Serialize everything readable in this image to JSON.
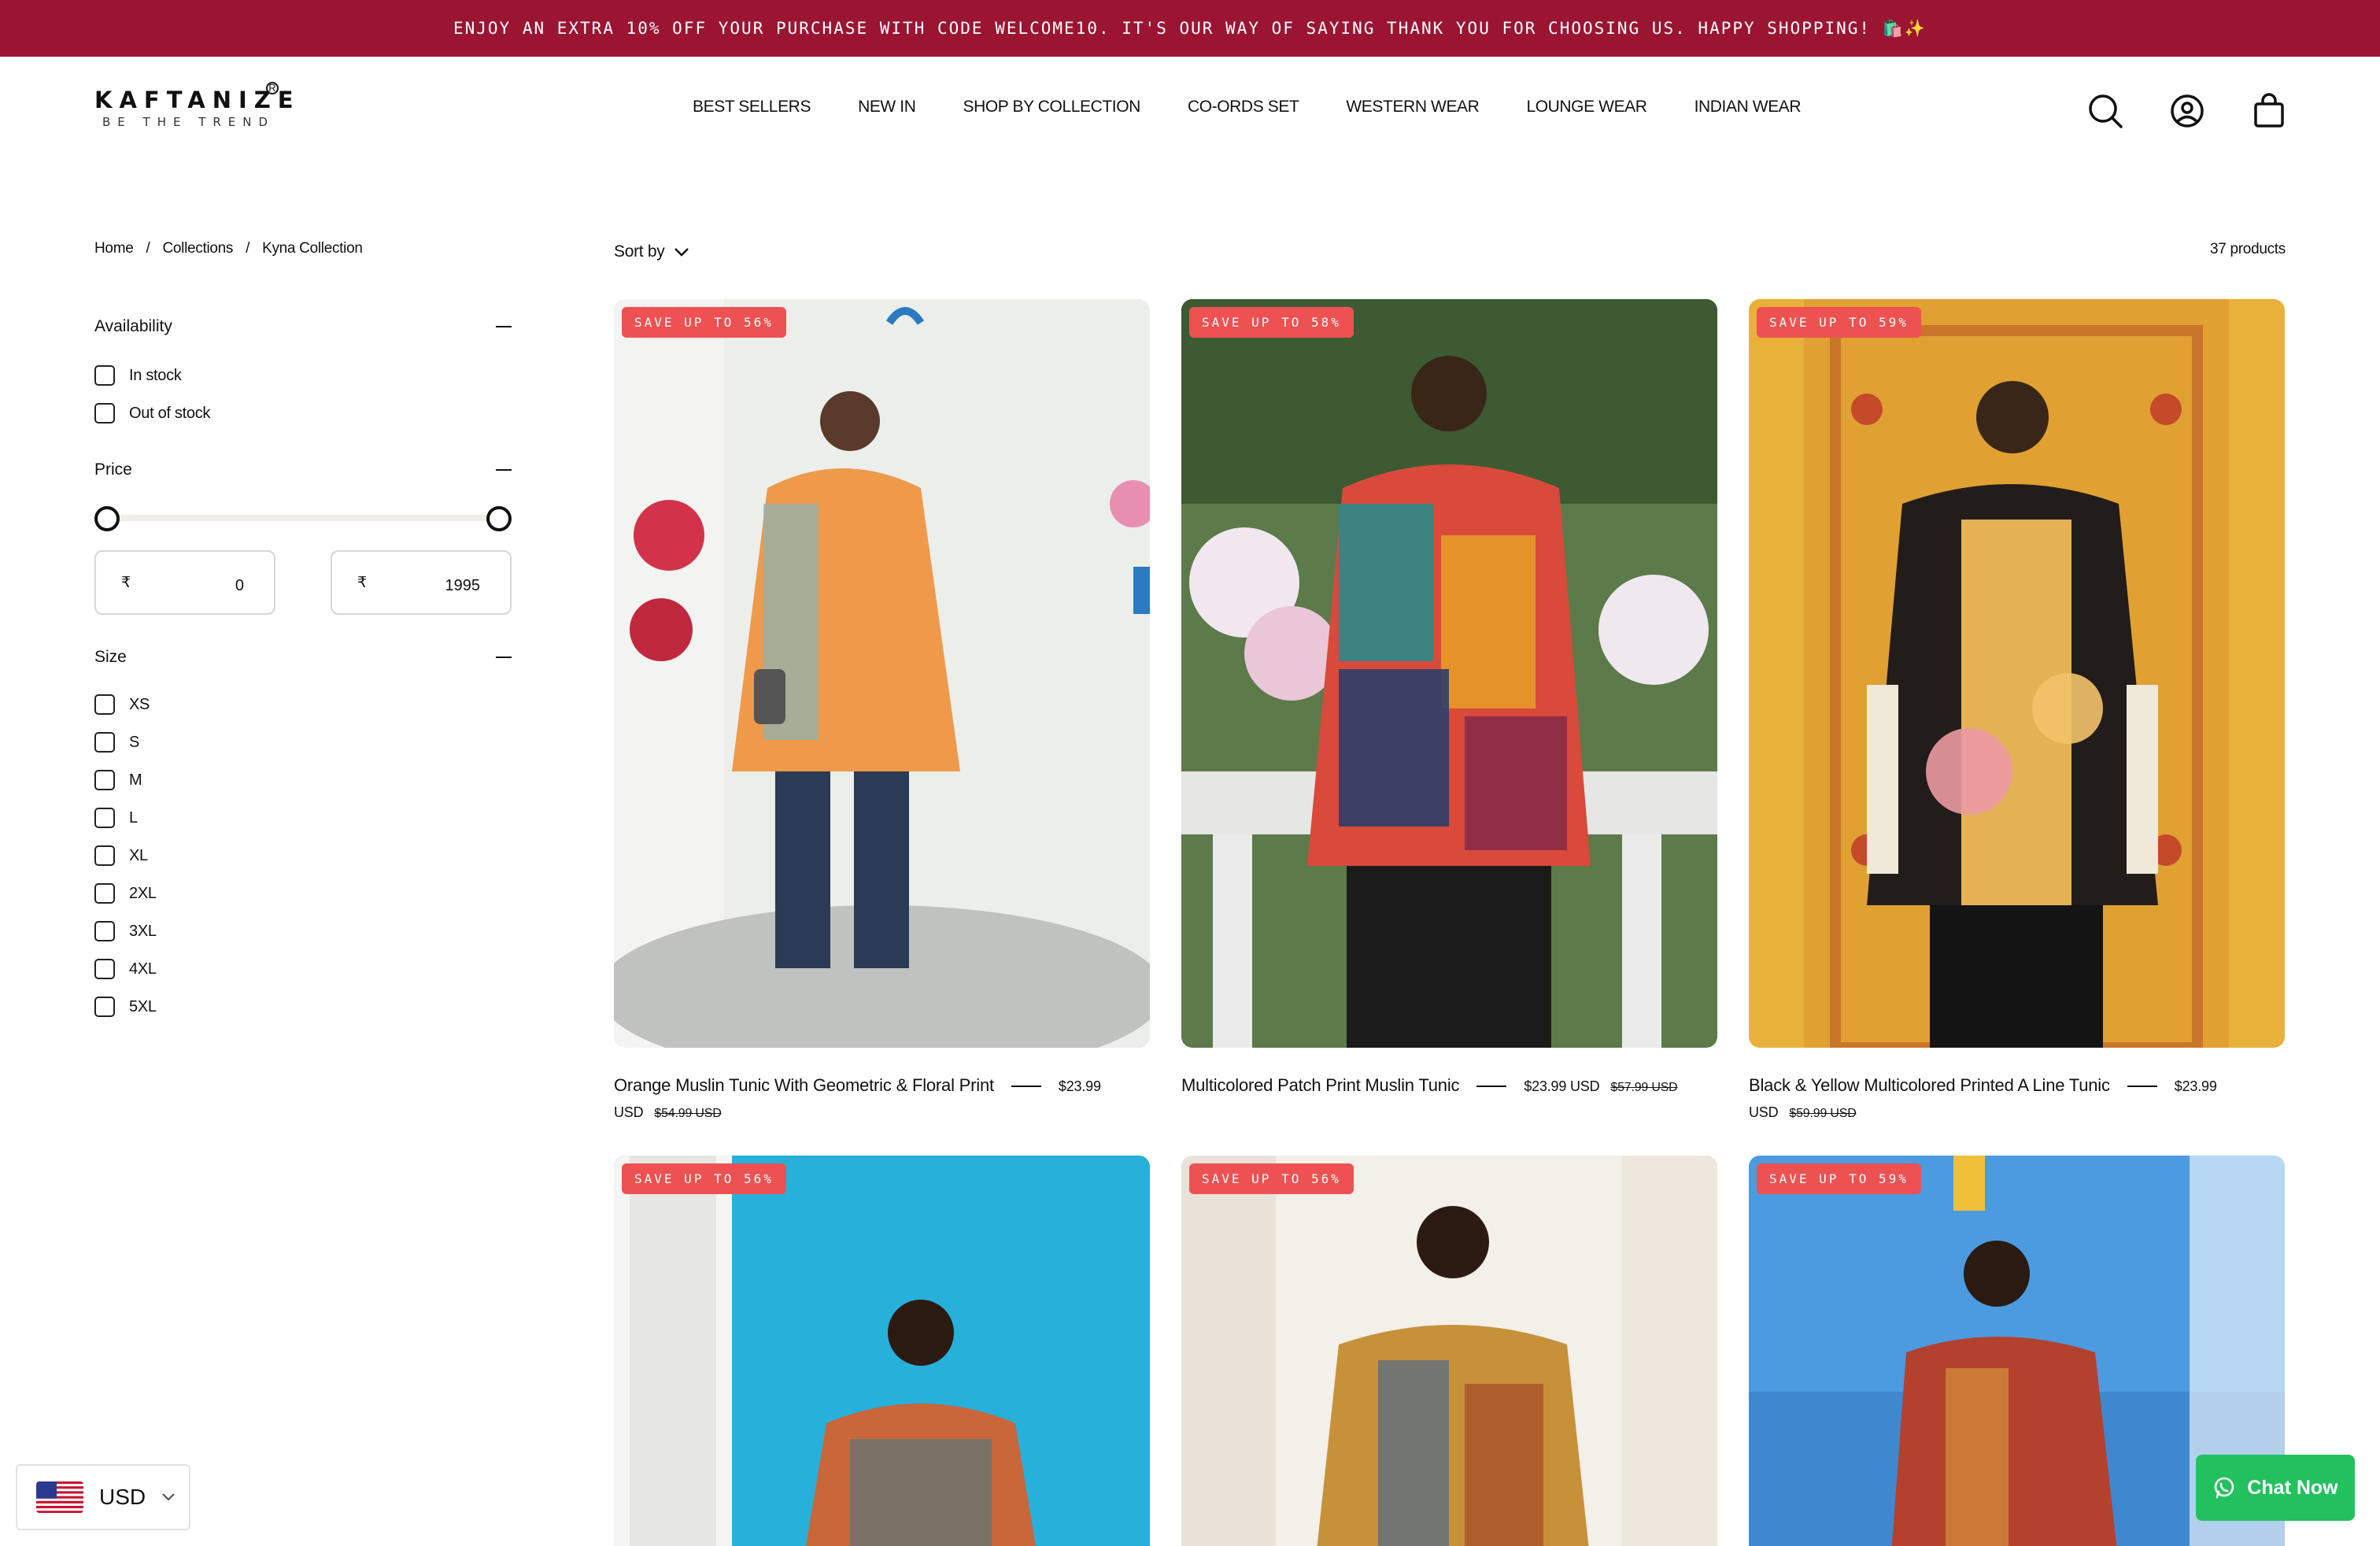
{
  "announcement": "ENJOY AN EXTRA 10% OFF YOUR PURCHASE WITH CODE WELCOME10. IT'S OUR WAY OF SAYING THANK YOU FOR CHOOSING US. HAPPY SHOPPING! 🛍️✨",
  "brand": {
    "name": "KAFTANIZE",
    "tagline": "BE THE TREND",
    "reg": "R"
  },
  "nav": [
    "BEST SELLERS",
    "NEW IN",
    "SHOP BY COLLECTION",
    "CO-ORDS SET",
    "WESTERN WEAR",
    "LOUNGE WEAR",
    "INDIAN WEAR"
  ],
  "header_icons": [
    "search-icon",
    "account-icon",
    "cart-icon"
  ],
  "breadcrumb": [
    "Home",
    "/",
    "Collections",
    "/",
    "Kyna Collection"
  ],
  "sort": {
    "label": "Sort by"
  },
  "product_count": "37 products",
  "filters": {
    "availability": {
      "title": "Availability",
      "options": [
        "In stock",
        "Out of stock"
      ]
    },
    "price": {
      "title": "Price",
      "currency": "₹",
      "min": "0",
      "max": "1995"
    },
    "size": {
      "title": "Size",
      "options": [
        "XS",
        "S",
        "M",
        "L",
        "XL",
        "2XL",
        "3XL",
        "4XL",
        "5XL"
      ]
    }
  },
  "products": [
    {
      "badge": "SAVE UP TO 56%",
      "title": "Orange Muslin Tunic With Geometric & Floral Print",
      "price": "$23.99 USD",
      "compare": "$54.99 USD"
    },
    {
      "badge": "SAVE UP TO 58%",
      "title": "Multicolored Patch Print Muslin Tunic",
      "price": "$23.99 USD",
      "compare": "$57.99 USD"
    },
    {
      "badge": "SAVE UP TO 59%",
      "title": "Black & Yellow Multicolored Printed A Line Tunic",
      "price": "$23.99 USD",
      "compare": "$59.99 USD"
    },
    {
      "badge": "SAVE UP TO 56%"
    },
    {
      "badge": "SAVE UP TO 56%"
    },
    {
      "badge": "SAVE UP TO 59%"
    }
  ],
  "currency_selector": {
    "code": "USD"
  },
  "chat": {
    "label": "Chat Now"
  },
  "colors": {
    "announcement_bg": "#9b1533",
    "badge_bg": "#ee5151",
    "chat_bg": "#22c15e"
  }
}
